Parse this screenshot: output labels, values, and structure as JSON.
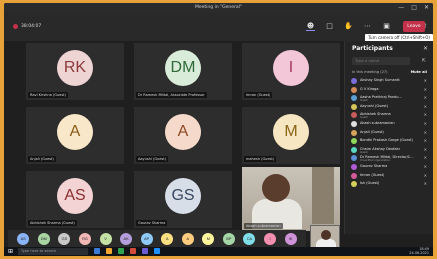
{
  "window": {
    "title": "Meeting in \"General\"",
    "controls": [
      "—",
      "□",
      "✕"
    ]
  },
  "toolbar": {
    "timer": "38:04:07",
    "leave_label": "Leave",
    "buttons": [
      "people-icon",
      "chat-icon",
      "hand-icon",
      "more-icon",
      "camera-icon",
      "mic-icon",
      "share-icon"
    ],
    "tooltip": "Turn camera off (Ctrl+Shift+O)"
  },
  "tiles": [
    {
      "initials": "RK",
      "name": "Ravi Krishna (Guest)",
      "bg": "#efd4d4",
      "fg": "#8a3a3a"
    },
    {
      "initials": "DM",
      "name": "Dr Ramesh Mittal, Associate Professor",
      "bg": "#d9ecd9",
      "fg": "#2f6a3a"
    },
    {
      "initials": "I",
      "name": "Imran (Guest)",
      "bg": "#f3c6d8",
      "fg": "#a3395f"
    },
    {
      "initials": "A",
      "name": "Anjali (Guest)",
      "bg": "#f8e8c9",
      "fg": "#8a5a17"
    },
    {
      "initials": "A",
      "name": "Aayushi (Guest)",
      "bg": "#f5dacb",
      "fg": "#8e4a26"
    },
    {
      "initials": "M",
      "name": "mahesh (Guest)",
      "bg": "#f6e6c2",
      "fg": "#8a6417"
    },
    {
      "initials": "AS",
      "name": "Abhishek Sharma (Guest)",
      "bg": "#f3d3d3",
      "fg": "#8b2f2f"
    },
    {
      "initials": "GS",
      "name": "Gaurav Sharma",
      "bg": "#d8dee8",
      "fg": "#37485f"
    },
    {
      "video": true,
      "name": "Akash subramanian"
    }
  ],
  "panel": {
    "title": "Participants",
    "search_placeholder": "Type a name",
    "section_label": "In this meeting (27)",
    "mute_all": "Mute all",
    "people": [
      {
        "name": "Akshay Singh Sumantt",
        "sub": "",
        "color": "#7a6fd6"
      },
      {
        "name": "G V Kiraga",
        "sub": "",
        "color": "#d68a5a"
      },
      {
        "name": "Aasha Prathiraj Pandu...",
        "sub": "Guest",
        "color": "#5aa0d6"
      },
      {
        "name": "Aayushi (Guest)",
        "sub": "",
        "color": "#d6c35a"
      },
      {
        "name": "Abhishek Sharma",
        "sub": "Guest",
        "color": "#c75a5a"
      },
      {
        "name": "Akash subramanian",
        "sub": "",
        "color": "#e0e0e0"
      },
      {
        "name": "Anjali (Guest)",
        "sub": "",
        "color": "#d6a35a"
      },
      {
        "name": "Bondhi Prakash Gorge (Guest)",
        "sub": "",
        "color": "#8fd65a"
      },
      {
        "name": "Chaim Akshay Deotkar",
        "sub": "Guest",
        "color": "#5ad6c3"
      },
      {
        "name": "Dr Ramesh Mittal, Director/C...",
        "sub": "Unverified organization",
        "color": "#5a8fd6"
      },
      {
        "name": "Gaurav Sharma",
        "sub": "",
        "color": "#b05ad6"
      },
      {
        "name": "Imran (Guest)",
        "sub": "",
        "color": "#d65a9a"
      },
      {
        "name": "Ish (Guest)",
        "sub": "",
        "color": "#d6d05a"
      }
    ]
  },
  "meetbar": {
    "avatars": [
      {
        "t": "AS",
        "c": "#8ab4f8"
      },
      {
        "t": "DM",
        "c": "#a8d5a2"
      },
      {
        "t": "GS",
        "c": "#c9c9c9"
      },
      {
        "t": "RG",
        "c": "#f2b8b5"
      },
      {
        "t": "V",
        "c": "#c5e1a5"
      },
      {
        "t": "AK",
        "c": "#b39ddb"
      },
      {
        "t": "AP",
        "c": "#90caf9"
      },
      {
        "t": "A",
        "c": "#ffe082"
      },
      {
        "t": "A",
        "c": "#ffcc80"
      },
      {
        "t": "M",
        "c": "#fff59d"
      },
      {
        "t": "BP",
        "c": "#a5d6a7"
      },
      {
        "t": "CA",
        "c": "#80deea"
      },
      {
        "t": "I",
        "c": "#f48fb1"
      },
      {
        "t": "IK",
        "c": "#ce93d8"
      }
    ]
  },
  "taskbar": {
    "search_placeholder": "Type here to search",
    "time": "18:49",
    "date": "24-06-2021",
    "apps": [
      "#3a7bd5",
      "#f0a830",
      "#2ea44f",
      "#d54b3a",
      "#6b5bd5",
      "#1e90ff"
    ]
  }
}
